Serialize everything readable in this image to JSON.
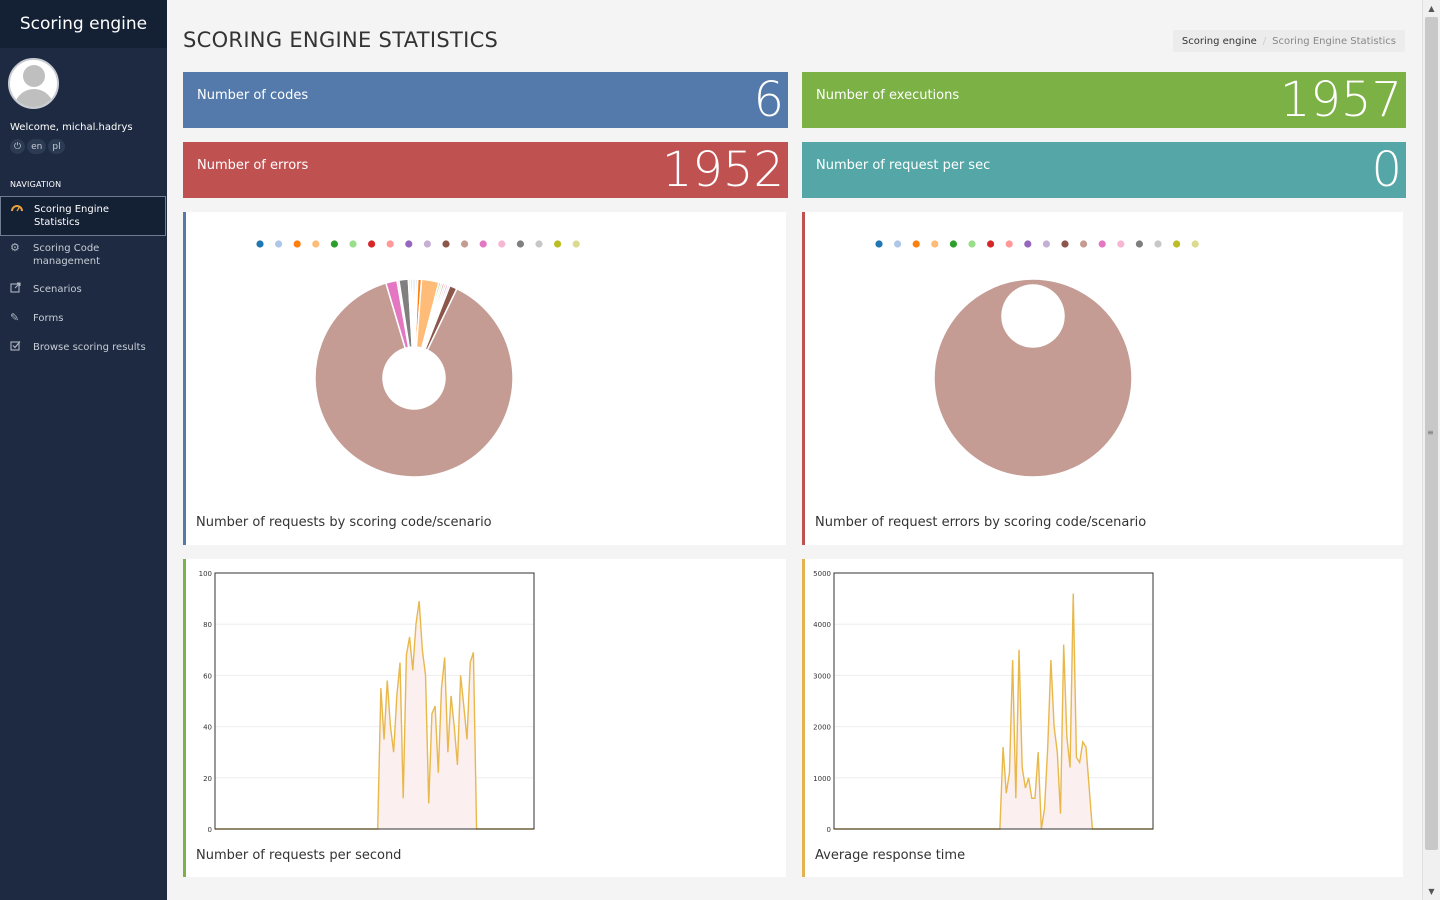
{
  "app": {
    "title": "Scoring engine"
  },
  "user": {
    "welcome": "Welcome, michal.hadrys",
    "power_icon": "power-icon",
    "languages": [
      "en",
      "pl"
    ]
  },
  "nav": {
    "heading": "NAVIGATION",
    "items": [
      {
        "label": "Scoring Engine Statistics",
        "icon": "dashboard-icon",
        "active": true
      },
      {
        "label": "Scoring Code management",
        "icon": "gear-icon",
        "active": false
      },
      {
        "label": "Scenarios",
        "icon": "external-link-icon",
        "active": false
      },
      {
        "label": "Forms",
        "icon": "pencil-icon",
        "active": false
      },
      {
        "label": "Browse scoring results",
        "icon": "checkbox-icon",
        "active": false
      }
    ]
  },
  "page": {
    "title": "SCORING ENGINE STATISTICS",
    "breadcrumb": [
      "Scoring engine",
      "Scoring Engine Statistics"
    ]
  },
  "stats": {
    "codes": {
      "label": "Number of codes",
      "value": "6",
      "color": "#547aab"
    },
    "executions": {
      "label": "Number of executions",
      "value": "1957",
      "color": "#7bb145"
    },
    "errors": {
      "label": "Number of errors",
      "value": "1952",
      "color": "#c05151"
    },
    "rps": {
      "label": "Number of request per sec",
      "value": "0",
      "color": "#55a6a6"
    }
  },
  "palette": [
    "#1f77b4",
    "#aec7e8",
    "#ff7f0e",
    "#ffbb78",
    "#2ca02c",
    "#98df8a",
    "#d62728",
    "#ff9896",
    "#9467bd",
    "#c5b0d5",
    "#8c564b",
    "#c49c94",
    "#e377c2",
    "#f7b6d2",
    "#7f7f7f",
    "#c7c7c7",
    "#bcbd22",
    "#dbdb8d"
  ],
  "chart_data": [
    {
      "type": "pie",
      "caption": "Number of requests by scoring code/scenario",
      "donut": true,
      "legend_dots": 18,
      "values": [
        0.3,
        0.3,
        0.6,
        2.8,
        0.3,
        0.3,
        0.3,
        0.3,
        0.3,
        0.3,
        1.2,
        86.8,
        1.8,
        0.3,
        1.5,
        0.3,
        0.3,
        0.3
      ]
    },
    {
      "type": "pie",
      "caption": "Number of request errors by scoring code/scenario",
      "donut": true,
      "legend_dots": 18,
      "values": [
        0,
        0,
        0,
        0,
        0,
        0,
        0,
        0,
        0,
        0,
        0,
        100,
        0,
        0,
        0,
        0,
        0,
        0
      ]
    },
    {
      "type": "area",
      "caption": "Number of requests per second",
      "ylim": [
        0,
        100
      ],
      "yticks": [
        0,
        20,
        40,
        60,
        80,
        100
      ],
      "color": "#e8b84a",
      "fill": "#fbeff0",
      "x": [
        0,
        1,
        2,
        3,
        4,
        5,
        6,
        7,
        8,
        9,
        10,
        11,
        12,
        13,
        14,
        15,
        16,
        17,
        18,
        19,
        20,
        21,
        22,
        23,
        24,
        25,
        26,
        27,
        28,
        29,
        30,
        31,
        32,
        33,
        34,
        35,
        36,
        37,
        38,
        39,
        40,
        41,
        42,
        43,
        44,
        45,
        46,
        47,
        48,
        49,
        50,
        51,
        52,
        53,
        54,
        55,
        56,
        57,
        58,
        59,
        60,
        61,
        62,
        63,
        64,
        65,
        66,
        67,
        68,
        69,
        70,
        71,
        72,
        73,
        74,
        75,
        76,
        77,
        78,
        79,
        80,
        81,
        82,
        83,
        84,
        85,
        86,
        87,
        88,
        89,
        90,
        91,
        92,
        93,
        94,
        95,
        96,
        97,
        98,
        99,
        100
      ],
      "y": [
        0,
        0,
        0,
        0,
        0,
        0,
        0,
        0,
        0,
        0,
        0,
        0,
        0,
        0,
        0,
        0,
        0,
        0,
        0,
        0,
        0,
        0,
        0,
        0,
        0,
        0,
        0,
        0,
        0,
        0,
        0,
        0,
        0,
        0,
        0,
        0,
        0,
        0,
        0,
        0,
        0,
        0,
        0,
        0,
        0,
        0,
        0,
        0,
        0,
        0,
        0,
        0,
        55,
        35,
        58,
        40,
        30,
        52,
        65,
        12,
        68,
        75,
        62,
        80,
        89,
        70,
        60,
        10,
        45,
        48,
        22,
        55,
        67,
        30,
        52,
        40,
        25,
        60,
        48,
        35,
        65,
        69,
        0,
        0,
        0,
        0,
        0,
        0,
        0,
        0,
        0,
        0,
        0,
        0,
        0,
        0,
        0,
        0,
        0,
        0,
        0
      ]
    },
    {
      "type": "area",
      "caption": "Average response time",
      "ylim": [
        0,
        5000
      ],
      "yticks": [
        0,
        1000,
        2000,
        3000,
        4000,
        5000
      ],
      "color": "#e8b84a",
      "fill": "#fbeff0",
      "x": [
        0,
        1,
        2,
        3,
        4,
        5,
        6,
        7,
        8,
        9,
        10,
        11,
        12,
        13,
        14,
        15,
        16,
        17,
        18,
        19,
        20,
        21,
        22,
        23,
        24,
        25,
        26,
        27,
        28,
        29,
        30,
        31,
        32,
        33,
        34,
        35,
        36,
        37,
        38,
        39,
        40,
        41,
        42,
        43,
        44,
        45,
        46,
        47,
        48,
        49,
        50,
        51,
        52,
        53,
        54,
        55,
        56,
        57,
        58,
        59,
        60,
        61,
        62,
        63,
        64,
        65,
        66,
        67,
        68,
        69,
        70,
        71,
        72,
        73,
        74,
        75,
        76,
        77,
        78,
        79,
        80,
        81,
        82,
        83,
        84,
        85,
        86,
        87,
        88,
        89,
        90,
        91,
        92,
        93,
        94,
        95,
        96,
        97,
        98,
        99,
        100
      ],
      "y": [
        0,
        0,
        0,
        0,
        0,
        0,
        0,
        0,
        0,
        0,
        0,
        0,
        0,
        0,
        0,
        0,
        0,
        0,
        0,
        0,
        0,
        0,
        0,
        0,
        0,
        0,
        0,
        0,
        0,
        0,
        0,
        0,
        0,
        0,
        0,
        0,
        0,
        0,
        0,
        0,
        0,
        0,
        0,
        0,
        0,
        0,
        0,
        0,
        0,
        0,
        0,
        0,
        0,
        1600,
        700,
        1100,
        3300,
        600,
        3500,
        1200,
        800,
        1000,
        600,
        600,
        1500,
        0,
        400,
        1600,
        3300,
        2000,
        1500,
        300,
        3600,
        1800,
        1200,
        4600,
        1400,
        1300,
        1700,
        1600,
        800,
        0,
        0,
        0,
        0,
        0,
        0,
        0,
        0,
        0,
        0,
        0,
        0,
        0,
        0,
        0,
        0,
        0,
        0,
        0,
        0
      ]
    }
  ]
}
